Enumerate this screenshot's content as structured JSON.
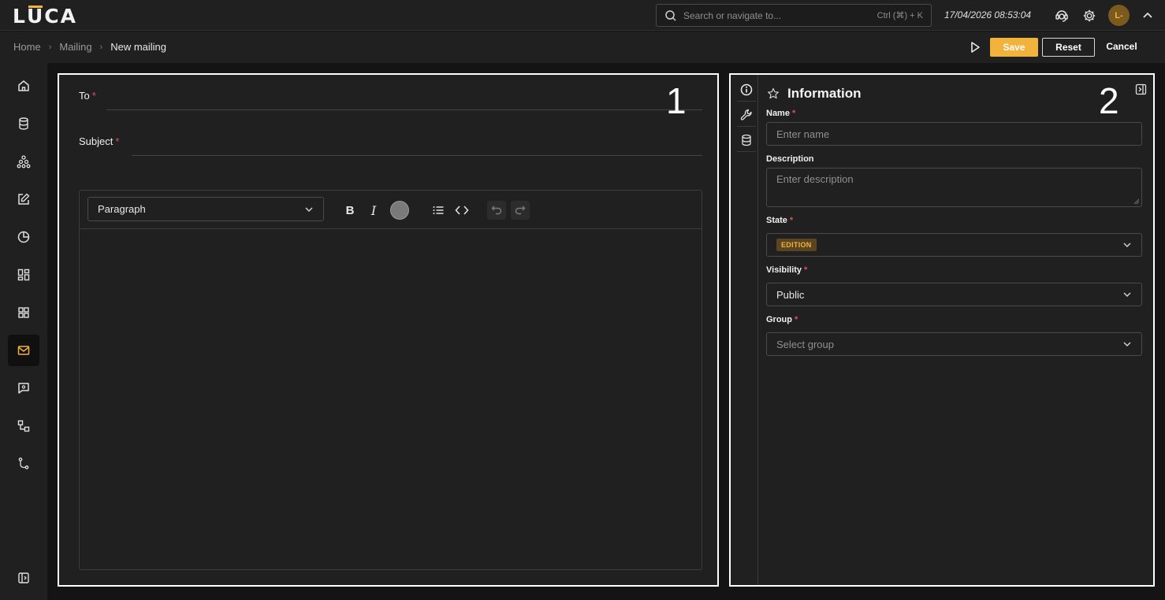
{
  "app": {
    "logo_l": "L",
    "logo_u": "U",
    "logo_rest": "CA"
  },
  "topbar": {
    "search_placeholder": "Search or navigate to...",
    "search_shortcut": "Ctrl (⌘) + K",
    "datetime": "17/04/2026 08:53:04",
    "avatar_initials": "L-"
  },
  "breadcrumb": {
    "items": [
      "Home",
      "Mailing",
      "New mailing"
    ]
  },
  "actions": {
    "save": "Save",
    "reset": "Reset",
    "cancel": "Cancel"
  },
  "sidebar": {
    "items": [
      "home-icon",
      "database-icon",
      "hierarchy-icon",
      "edit-icon",
      "pie-chart-icon",
      "dashboard-icon",
      "apps-icon",
      "mail-icon",
      "chat-icon",
      "workflow-icon",
      "git-branch-icon"
    ],
    "active": "mail-icon",
    "footer": "collapse-sidebar-icon"
  },
  "mail_form": {
    "panel_number": "1",
    "to_label": "To",
    "subject_label": "Subject",
    "required_mark": "*",
    "editor": {
      "block_type": "Paragraph",
      "bold": "B",
      "italic": "I"
    }
  },
  "info_panel": {
    "panel_number": "2",
    "title": "Information",
    "required_mark": "*",
    "name_label": "Name",
    "name_placeholder": "Enter name",
    "description_label": "Description",
    "description_placeholder": "Enter description",
    "state_label": "State",
    "state_value": "EDITION",
    "visibility_label": "Visibility",
    "visibility_value": "Public",
    "group_label": "Group",
    "group_placeholder": "Select group",
    "tabs": [
      "info-icon",
      "wrench-icon",
      "database-icon"
    ]
  },
  "colors": {
    "accent": "#f2b33d",
    "background": "#141414",
    "panel": "#202020",
    "required": "#e05252"
  }
}
